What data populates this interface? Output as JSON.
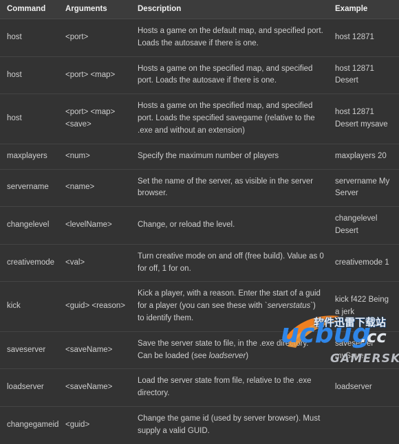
{
  "table": {
    "columns": [
      "Command",
      "Arguments",
      "Description",
      "Example"
    ],
    "rows": [
      {
        "command": "host",
        "arguments": "<port>",
        "description": "Hosts a game on the default map, and specified port. Loads the autosave if there is one.",
        "example": "host 12871"
      },
      {
        "command": "host",
        "arguments": "<port> <map>",
        "description": "Hosts a game on the specified map, and specified port. Loads the autosave if there is one.",
        "example": "host 12871 Desert"
      },
      {
        "command": "host",
        "arguments": "<port> <map> <save>",
        "description": "Hosts a game on the specified map, and specified port. Loads the specified savegame (relative to the .exe and without an extension)",
        "example": "host 12871 Desert mysave"
      },
      {
        "command": "maxplayers",
        "arguments": "<num>",
        "description": "Specify the maximum number of players",
        "example": "maxplayers 20"
      },
      {
        "command": "servername",
        "arguments": "<name>",
        "description": "Set the name of the server, as visible in the server browser.",
        "example": "servername My Server"
      },
      {
        "command": "changelevel",
        "arguments": "<levelName>",
        "description": "Change, or reload the level.",
        "example": "changelevel Desert"
      },
      {
        "command": "creativemode",
        "arguments": "<val>",
        "description": "Turn creative mode on and off (free build). Value as 0 for off, 1 for on.",
        "example": "creativemode 1"
      },
      {
        "command": "kick",
        "arguments": "<guid> <reason>",
        "description_pre": "Kick a player, with a reason. Enter the start of a guid for a player (you can see these with `",
        "description_em": "serverstatus",
        "description_post": "`) to identify them.",
        "example": "kick f422 Being a jerk"
      },
      {
        "command": "saveserver",
        "arguments": "<saveName>",
        "description_pre": "Save the server state to file, in the .exe directory. Can be loaded (see ",
        "description_em": "loadserver",
        "description_post": ")",
        "example": "saveserver mySave"
      },
      {
        "command": "loadserver",
        "arguments": "<saveName>",
        "description": "Load the server state from file, relative to the .exe directory.",
        "example": "loadserver"
      },
      {
        "command": "changegameid",
        "arguments": "<guid>",
        "description": "Change the game id (used by server browser). Must supply a valid GUID.",
        "example": ""
      }
    ]
  },
  "watermark": {
    "chinese_text": "软件迅雷下载站",
    "brand": "ucbug",
    "tld": ".cc",
    "publisher": "GAMERSKY",
    "colors": {
      "brand_blue": "#2f86e8",
      "swoosh_orange": "#f08020",
      "publisher_gray": "#b9bcc2"
    }
  },
  "theme": {
    "page_background": "#333333",
    "header_background": "#3c3c3c",
    "row_background": "#333333",
    "row_divider": "#444444",
    "header_text": "#f0f0f0",
    "body_text": "#cfcfcf"
  }
}
